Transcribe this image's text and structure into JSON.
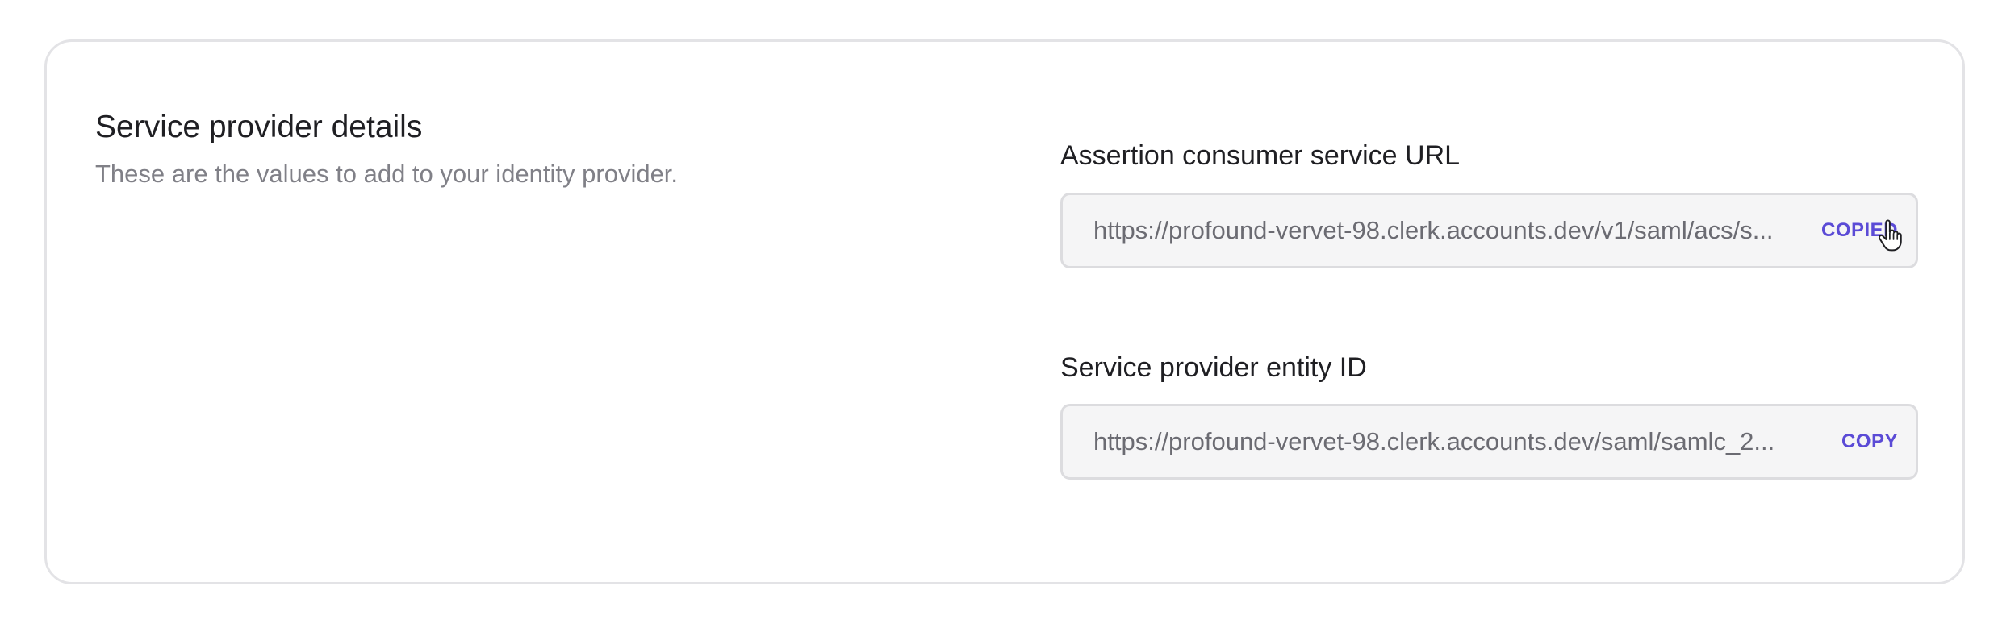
{
  "section": {
    "title": "Service provider details",
    "description": "These are the values to add to your identity provider."
  },
  "fields": [
    {
      "label": "Assertion consumer service URL",
      "value": "https://profound-vervet-98.clerk.accounts.dev/v1/saml/acs/s...",
      "action_label": "COPIED"
    },
    {
      "label": "Service provider entity ID",
      "value": "https://profound-vervet-98.clerk.accounts.dev/saml/samlc_2...",
      "action_label": "COPY"
    }
  ],
  "colors": {
    "accent": "#5b4bd6",
    "field_background": "#f5f5f6",
    "border": "#e3e3e6"
  },
  "icons": {
    "cursor": "hand-pointer-cursor-icon"
  }
}
